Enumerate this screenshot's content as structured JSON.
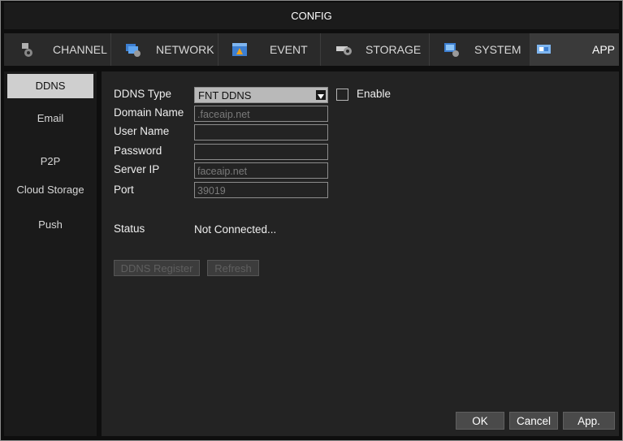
{
  "window": {
    "title": "CONFIG"
  },
  "tabs": [
    {
      "label": "CHANNEL",
      "icon": "camera-gear-icon"
    },
    {
      "label": "NETWORK",
      "icon": "network-gear-icon"
    },
    {
      "label": "EVENT",
      "icon": "event-icon"
    },
    {
      "label": "STORAGE",
      "icon": "storage-gear-icon"
    },
    {
      "label": "SYSTEM",
      "icon": "system-gear-icon"
    },
    {
      "label": "APP",
      "icon": "app-icon"
    }
  ],
  "sidebar": {
    "items": [
      {
        "label": "DDNS"
      },
      {
        "label": "Email"
      },
      {
        "label": "P2P"
      },
      {
        "label": "Cloud Storage"
      },
      {
        "label": "Push"
      }
    ]
  },
  "form": {
    "ddns_type_label": "DDNS Type",
    "ddns_type_value": "FNT DDNS",
    "enable_label": "Enable",
    "enable_checked": false,
    "domain_name_label": "Domain Name",
    "domain_name_value": ".faceaip.net",
    "user_name_label": "User Name",
    "user_name_value": "",
    "password_label": "Password",
    "password_value": "",
    "server_ip_label": "Server IP",
    "server_ip_value": "faceaip.net",
    "port_label": "Port",
    "port_value": "39019",
    "status_label": "Status",
    "status_value": "Not Connected...",
    "ddns_register_label": "DDNS Register",
    "refresh_label": "Refresh"
  },
  "footer": {
    "ok_label": "OK",
    "cancel_label": "Cancel",
    "apply_label": "App."
  },
  "colors": {
    "background": "#0e0e0e",
    "panel": "#232323",
    "tab_bar": "#2a2a2a",
    "active_sidebar": "#cfcfcf"
  }
}
